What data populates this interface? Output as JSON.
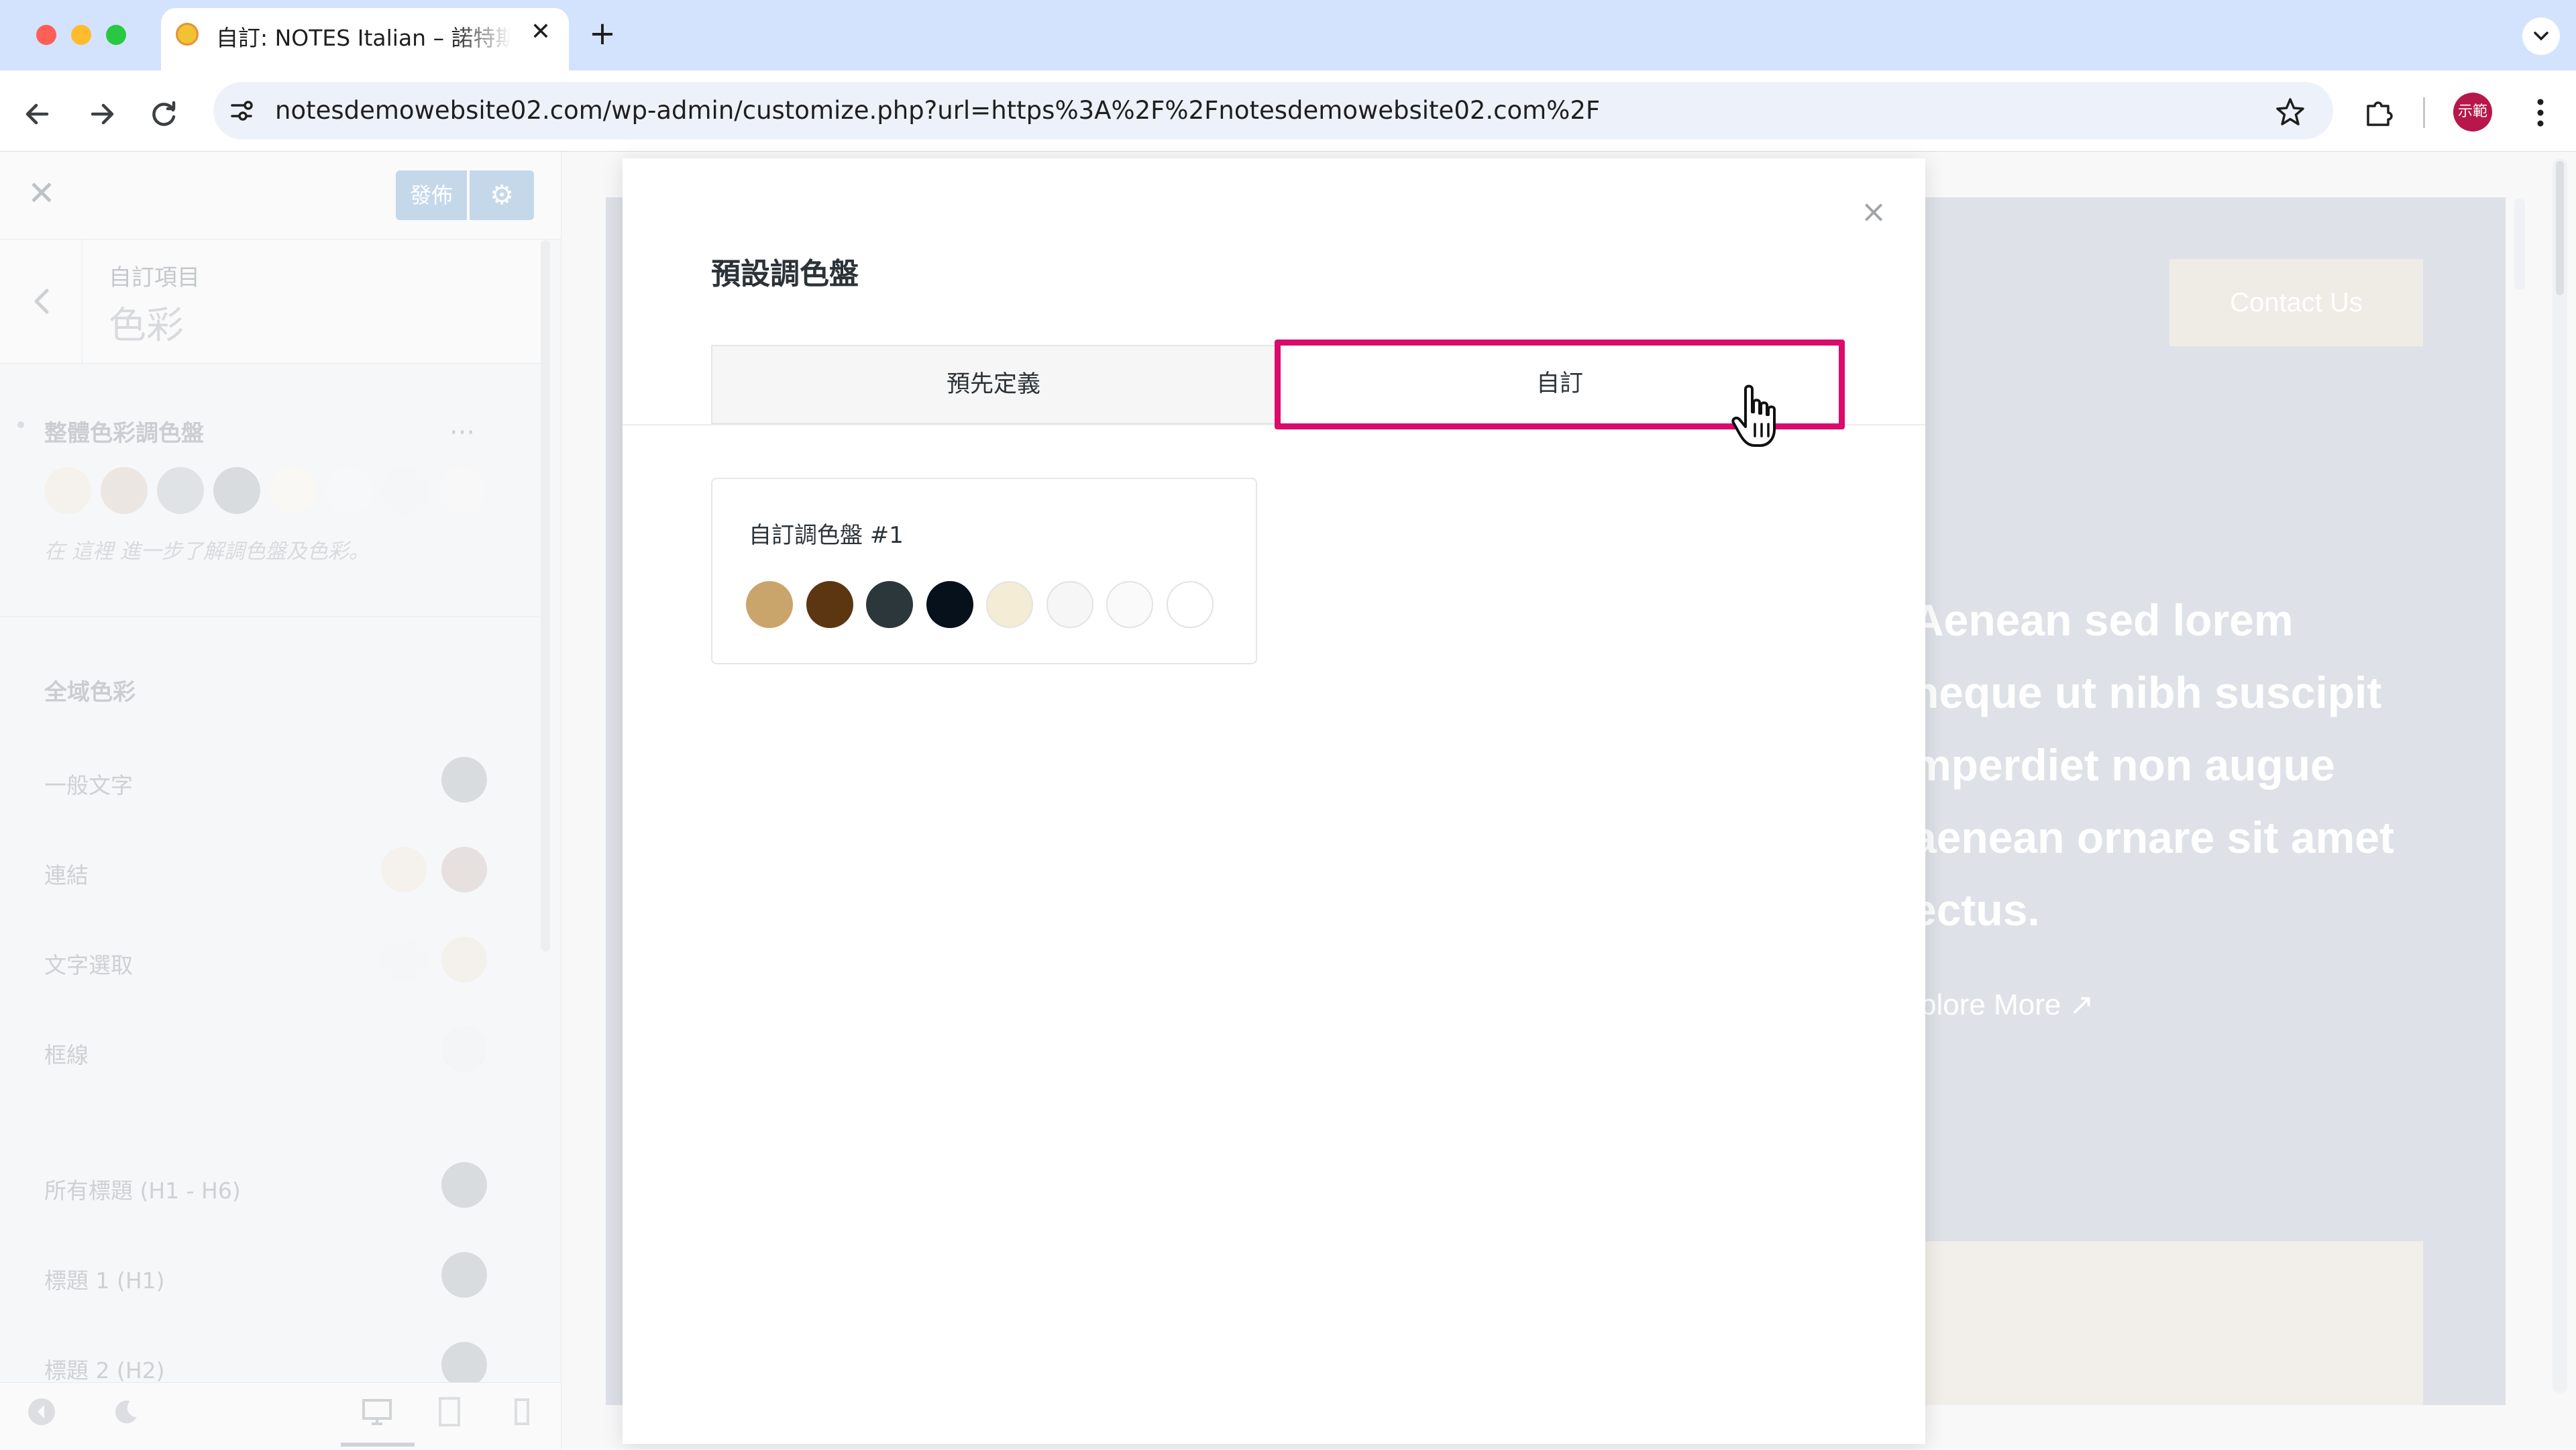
{
  "browser": {
    "tab_title": "自訂: NOTES Italian – 諾特斯義",
    "tab_close": "✕",
    "new_tab": "+",
    "url": "notesdemowebsite02.com/wp-admin/customize.php?url=https%3A%2F%2Fnotesdemowebsite02.com%2F",
    "profile_label": "示範"
  },
  "sidebar": {
    "close": "✕",
    "publish_label": "發佈",
    "breadcrumb": "自訂項目",
    "section_title": "色彩",
    "palette_heading": "整體色彩調色盤",
    "palette_more": "···",
    "palette_hint": "在 這裡 進一步了解調色盤及色彩。",
    "palette_colors": [
      "#f0ebe3",
      "#e2d9d4",
      "#cfd4d8",
      "#c5cacd",
      "#f6f4ee",
      "#f2f4f6",
      "#eef1f3",
      "#f4f5f6"
    ],
    "global_heading": "全域色彩",
    "rows": [
      {
        "label": "一般文字",
        "colors": [
          "#c5cacd"
        ]
      },
      {
        "label": "連結",
        "colors": [
          "#f0ebe3",
          "#d9d1cd"
        ]
      },
      {
        "label": "文字選取",
        "colors": [
          "#eef1f3",
          "#efeae2"
        ]
      },
      {
        "label": "框線",
        "colors": [
          "#eef0f1"
        ]
      },
      {
        "label": "所有標題 (H1 - H6)",
        "colors": [
          "#c5cacd"
        ]
      },
      {
        "label": "標題 1 (H1)",
        "colors": [
          "#c5cacd"
        ]
      },
      {
        "label": "標題 2 (H2)",
        "colors": [
          "#c5cacd"
        ]
      }
    ]
  },
  "preview": {
    "contact_label": "Contact Us",
    "hero_lines": [
      "Aenean sed lorem",
      "neque ut nibh suscipit",
      "mperdiet non augue",
      "aenean ornare sit amet",
      "ectus."
    ],
    "explore_label": "xplore More  ↗"
  },
  "modal": {
    "title": "預設調色盤",
    "close": "×",
    "tabs": [
      {
        "label": "預先定義",
        "active": false
      },
      {
        "label": "自訂",
        "active": true
      }
    ],
    "palette": {
      "name": "自訂調色盤 #1",
      "colors": [
        "#c9a56c",
        "#5c3610",
        "#2c373c",
        "#06111c",
        "#f4ecd5",
        "#f6f6f6",
        "#fafafa",
        "#ffffff"
      ]
    },
    "highlight_color": "#db0b6c"
  }
}
